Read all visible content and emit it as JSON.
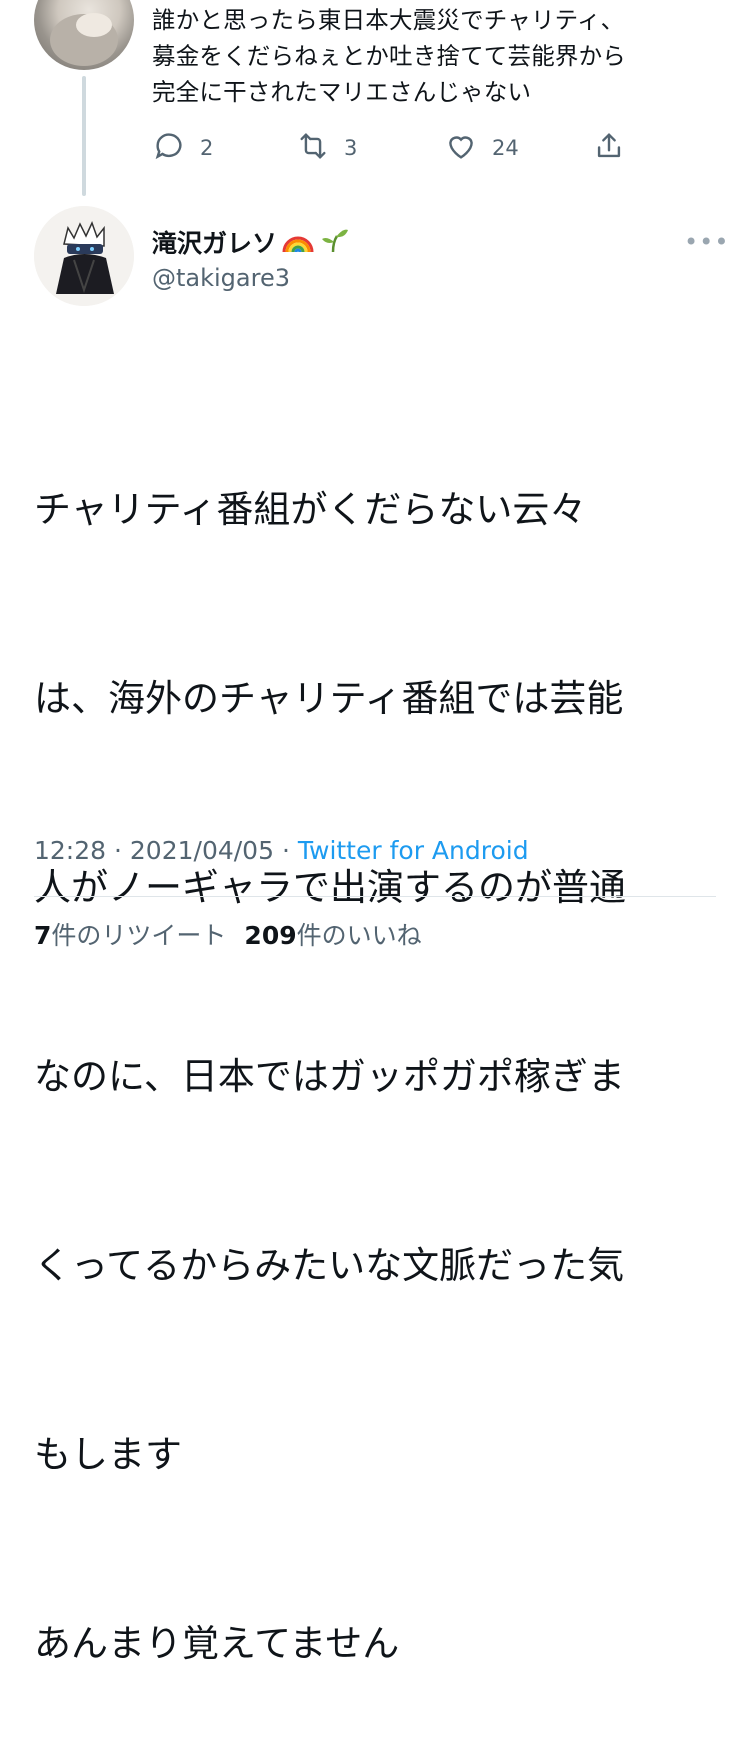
{
  "reply": {
    "lines": [
      "誰かと思ったら東日本大震災でチャリティ、",
      "募金をくだらねぇとか吐き捨てて芸能界から",
      "完全に干されたマリエさんじゃない"
    ],
    "actions": {
      "reply_count": "2",
      "retweet_count": "3",
      "like_count": "24"
    }
  },
  "author": {
    "name": "滝沢ガレソ",
    "handle": "@takigare3",
    "more_label": "•••"
  },
  "tweet": {
    "lines": [
      "チャリティ番組がくだらない云々",
      "は、海外のチャリティ番組では芸能",
      "人がノーギャラで出演するのが普通",
      "なのに、日本ではガッポガポ稼ぎま",
      "くってるからみたいな文脈だった気",
      "もします",
      "あんまり覚えてません"
    ],
    "time": "12:28",
    "date": "2021/04/05",
    "separator": "·",
    "source": "Twitter for Android"
  },
  "stats": {
    "retweets_count": "7",
    "retweets_label": "件のリツイート",
    "likes_count": "209",
    "likes_label": "件のいいね"
  },
  "colors": {
    "text": "#0f1419",
    "secondary": "#536471",
    "link": "#1d9bf0",
    "divider": "#dfe5e9"
  },
  "icons": [
    "reply-icon",
    "retweet-icon",
    "like-icon",
    "share-icon",
    "rainbow-icon",
    "seedling-icon",
    "more-icon"
  ]
}
